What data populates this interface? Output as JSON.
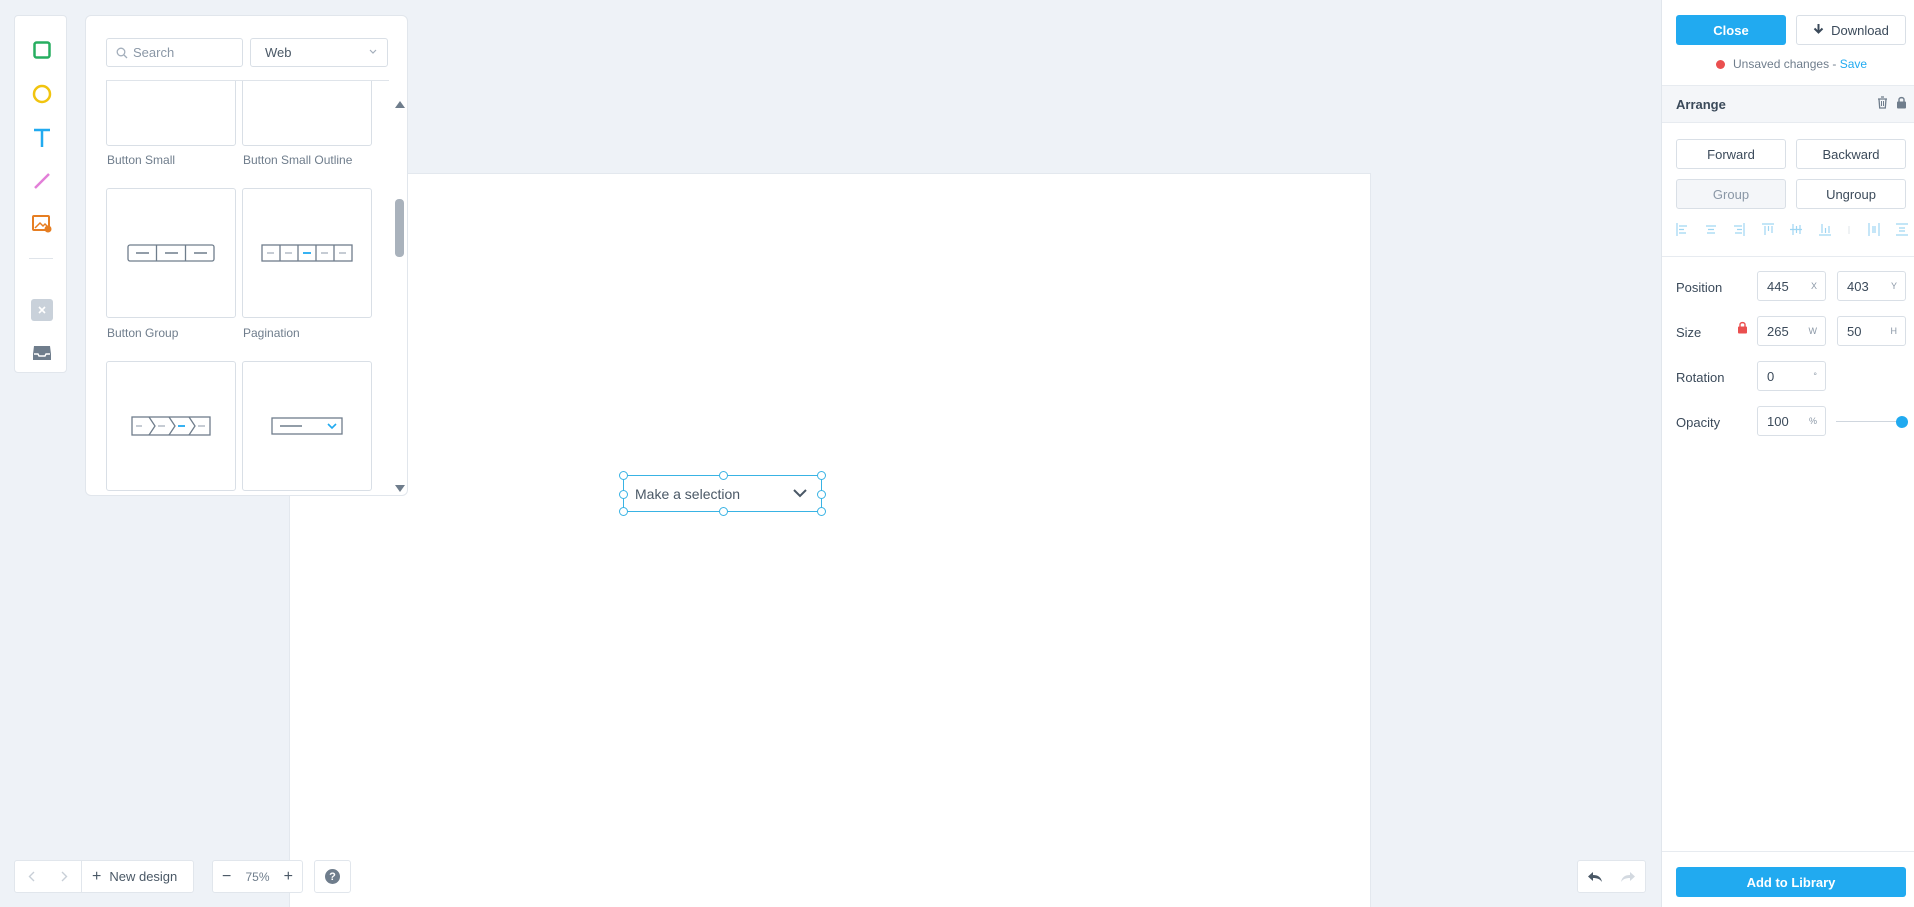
{
  "library": {
    "search_placeholder": "Search",
    "category": "Web",
    "items": [
      {
        "label": "Button Small"
      },
      {
        "label": "Button Small Outline"
      },
      {
        "label": "Button Group"
      },
      {
        "label": "Pagination"
      },
      {
        "label": ""
      },
      {
        "label": ""
      }
    ]
  },
  "canvas": {
    "selected_element_text": "Make a selection"
  },
  "bottom": {
    "new_design_label": "New design",
    "zoom_level": "75%",
    "help_glyph": "?"
  },
  "panel": {
    "close_label": "Close",
    "download_label": "Download",
    "unsaved_text": "Unsaved changes -",
    "save_label": "Save",
    "arrange_title": "Arrange",
    "forward_label": "Forward",
    "backward_label": "Backward",
    "group_label": "Group",
    "ungroup_label": "Ungroup",
    "position_label": "Position",
    "size_label": "Size",
    "rotation_label": "Rotation",
    "opacity_label": "Opacity",
    "position_x": "445",
    "position_y": "403",
    "unit_x": "X",
    "unit_y": "Y",
    "size_w": "265",
    "size_h": "50",
    "unit_w": "W",
    "unit_h": "H",
    "rotation": "0",
    "unit_deg": "°",
    "opacity": "100",
    "unit_pct": "%",
    "opacity_slider_value": 1.0,
    "add_to_library_label": "Add to Library"
  },
  "colors": {
    "accent": "#21aaf0",
    "rect_tool": "#27ae60",
    "ellipse_tool": "#f1c40f",
    "text_tool": "#21aaf0",
    "line_tool": "#e27fd8",
    "image_tool": "#e67e22",
    "unsaved_dot": "#ea4f4f"
  },
  "icons": {
    "tools": [
      "rectangle-icon",
      "ellipse-icon",
      "text-icon",
      "line-icon",
      "image-icon",
      "clear-icon",
      "inbox-icon"
    ]
  }
}
